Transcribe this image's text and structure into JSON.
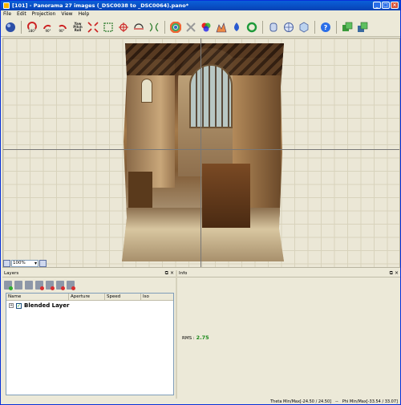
{
  "window": {
    "title": "[101] - Panorama 27 images (_DSC0038 to _DSC0064).pano*"
  },
  "menu": [
    "File",
    "Edit",
    "Projection",
    "View",
    "Help"
  ],
  "toolbar": {
    "btn_left_label": "180°",
    "btn_90cw_label": "90°",
    "btn_90ccw_label": "90°",
    "yaw_pitch_roll_lines": [
      "Yaw",
      "Pitch",
      "Roll"
    ]
  },
  "canvas": {
    "zoom": "100%"
  },
  "layers": {
    "title": "Layers",
    "columns": [
      "Name",
      "Aperture",
      "Speed",
      "Iso"
    ],
    "rows": [
      {
        "name": "Blended Layer",
        "checked": true
      }
    ]
  },
  "info": {
    "title": "Info",
    "rms_label": "RMS :",
    "rms_value": "2.75"
  },
  "status": {
    "theta": "Theta Min/Max[-24.50 / 24.50]",
    "sep": "--",
    "phi": "Phi Min/Max[-33.54 / 33.07]"
  },
  "colors": {
    "titlebar": "#0a5fd8",
    "chrome": "#ece9d8",
    "rms_value": "#1a8a1a"
  }
}
